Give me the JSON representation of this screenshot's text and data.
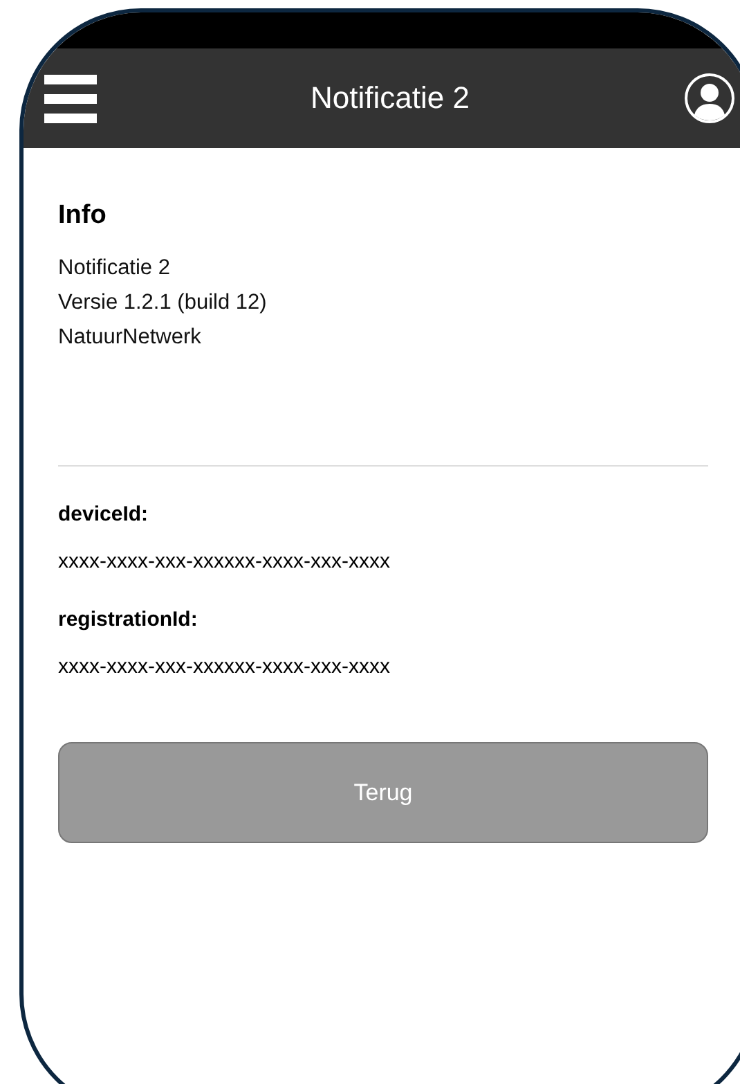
{
  "header": {
    "title": "Notificatie 2"
  },
  "info": {
    "heading": "Info",
    "lines": [
      "Notificatie 2",
      "Versie 1.2.1 (build 12)",
      "NatuurNetwerk"
    ]
  },
  "fields": [
    {
      "label": "deviceId:",
      "value": "xxxx-xxxx-xxx-xxxxxx-xxxx-xxx-xxxx"
    },
    {
      "label": "registrationId:",
      "value": "xxxx-xxxx-xxx-xxxxxx-xxxx-xxx-xxxx"
    }
  ],
  "button": {
    "label": "Terug",
    "disabled": true
  }
}
